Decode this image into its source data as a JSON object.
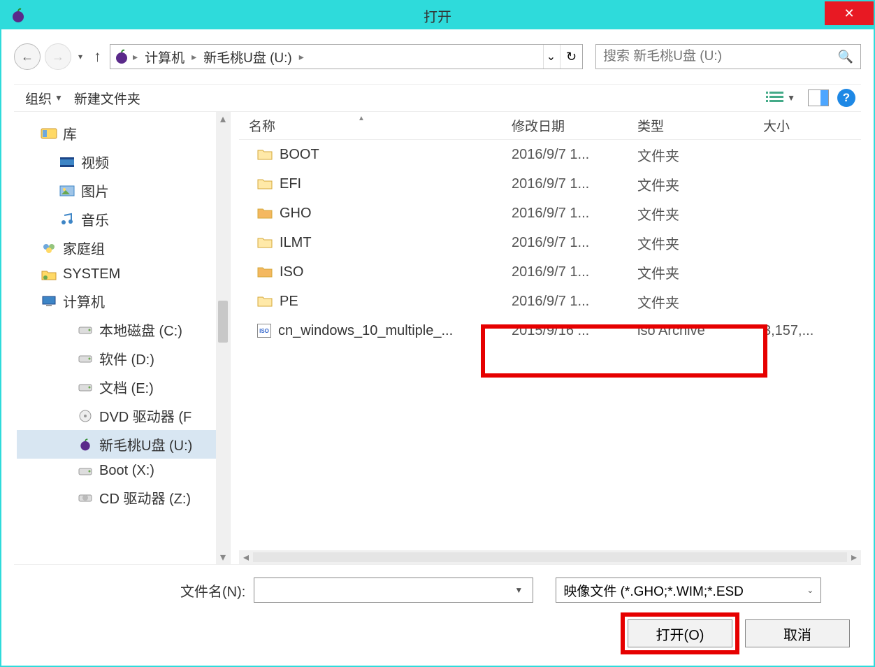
{
  "window": {
    "title": "打开"
  },
  "nav": {
    "crumbs": [
      "计算机",
      "新毛桃U盘 (U:)"
    ],
    "search_placeholder": "搜索 新毛桃U盘 (U:)"
  },
  "toolbar": {
    "organize": "组织",
    "new_folder": "新建文件夹"
  },
  "tree": {
    "items": [
      {
        "label": "库",
        "level": 1,
        "icon": "library"
      },
      {
        "label": "视频",
        "level": 2,
        "icon": "video"
      },
      {
        "label": "图片",
        "level": 2,
        "icon": "picture"
      },
      {
        "label": "音乐",
        "level": 2,
        "icon": "music"
      },
      {
        "label": "家庭组",
        "level": 1,
        "icon": "homegroup"
      },
      {
        "label": "SYSTEM",
        "level": 1,
        "icon": "sysfolder"
      },
      {
        "label": "计算机",
        "level": 1,
        "icon": "computer"
      },
      {
        "label": "本地磁盘 (C:)",
        "level": 3,
        "icon": "disk"
      },
      {
        "label": "软件 (D:)",
        "level": 3,
        "icon": "disk"
      },
      {
        "label": "文档 (E:)",
        "level": 3,
        "icon": "disk"
      },
      {
        "label": "DVD 驱动器 (F",
        "level": 3,
        "icon": "dvd"
      },
      {
        "label": "新毛桃U盘 (U:)",
        "level": 3,
        "icon": "peach",
        "selected": true
      },
      {
        "label": "Boot (X:)",
        "level": 3,
        "icon": "disk"
      },
      {
        "label": "CD 驱动器 (Z:)",
        "level": 3,
        "icon": "cd"
      }
    ]
  },
  "columns": {
    "name": "名称",
    "date": "修改日期",
    "type": "类型",
    "size": "大小"
  },
  "rows": [
    {
      "name": "BOOT",
      "date": "2016/9/7 1...",
      "type": "文件夹",
      "size": "",
      "kind": "folder"
    },
    {
      "name": "EFI",
      "date": "2016/9/7 1...",
      "type": "文件夹",
      "size": "",
      "kind": "folder"
    },
    {
      "name": "GHO",
      "date": "2016/9/7 1...",
      "type": "文件夹",
      "size": "",
      "kind": "folder-open"
    },
    {
      "name": "ILMT",
      "date": "2016/9/7 1...",
      "type": "文件夹",
      "size": "",
      "kind": "folder"
    },
    {
      "name": "ISO",
      "date": "2016/9/7 1...",
      "type": "文件夹",
      "size": "",
      "kind": "folder-open"
    },
    {
      "name": "PE",
      "date": "2016/9/7 1...",
      "type": "文件夹",
      "size": "",
      "kind": "folder"
    },
    {
      "name": "cn_windows_10_multiple_...",
      "date": "2015/9/16 ...",
      "type": "iso Archive",
      "size": "3,157,...",
      "kind": "iso"
    }
  ],
  "footer": {
    "filename_label": "文件名(N):",
    "filter_label": "映像文件 (*.GHO;*.WIM;*.ESD",
    "open": "打开(O)",
    "cancel": "取消"
  }
}
